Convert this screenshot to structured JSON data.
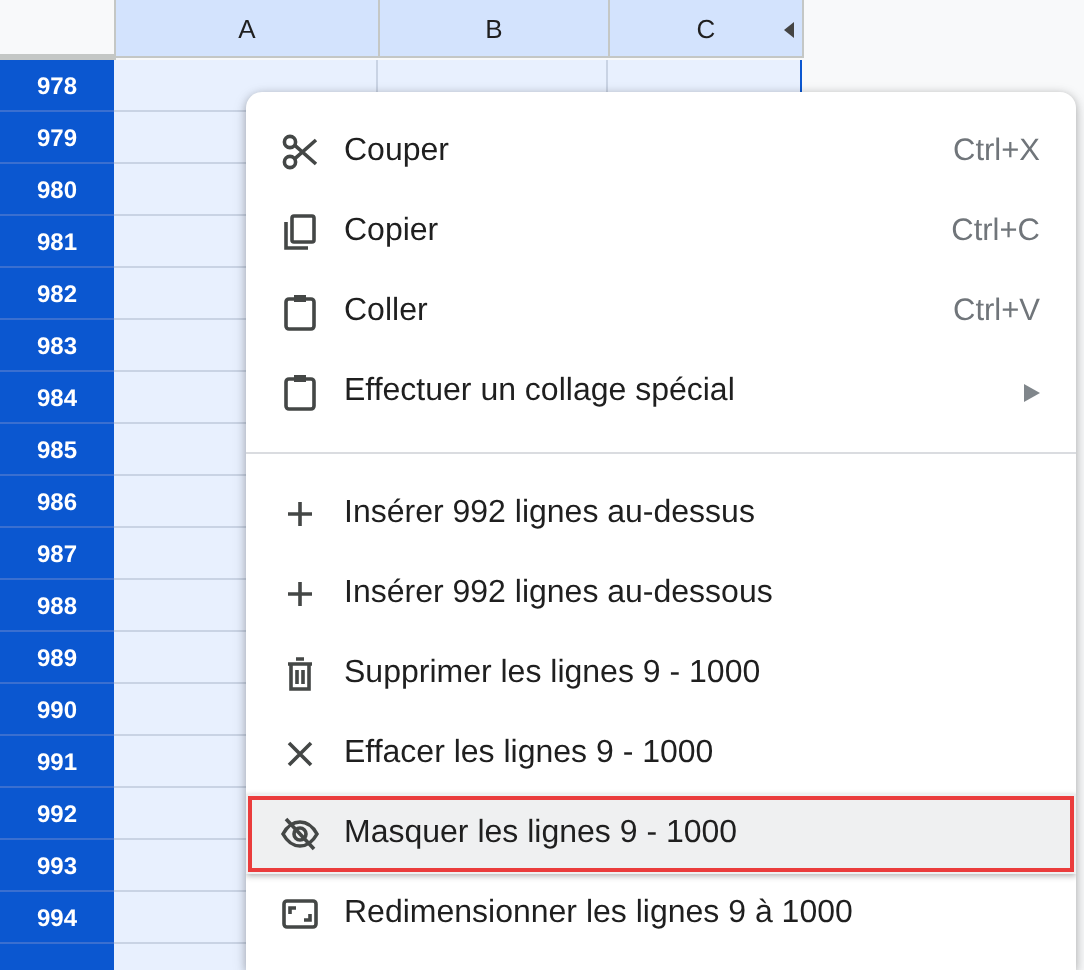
{
  "columns": [
    {
      "label": "A",
      "selected": true
    },
    {
      "label": "B",
      "selected": true
    },
    {
      "label": "C",
      "selected": true
    }
  ],
  "rows": [
    {
      "label": "978",
      "selected": true
    },
    {
      "label": "979",
      "selected": true
    },
    {
      "label": "980",
      "selected": true
    },
    {
      "label": "981",
      "selected": true
    },
    {
      "label": "982",
      "selected": true
    },
    {
      "label": "983",
      "selected": true
    },
    {
      "label": "984",
      "selected": true
    },
    {
      "label": "985",
      "selected": true
    },
    {
      "label": "986",
      "selected": true
    },
    {
      "label": "987",
      "selected": true
    },
    {
      "label": "988",
      "selected": true
    },
    {
      "label": "989",
      "selected": true
    },
    {
      "label": "990",
      "selected": true
    },
    {
      "label": "991",
      "selected": true
    },
    {
      "label": "992",
      "selected": true
    },
    {
      "label": "993",
      "selected": true
    },
    {
      "label": "994",
      "selected": true
    },
    {
      "selected": true
    }
  ],
  "context_menu": {
    "items": [
      {
        "kind": "item",
        "label": "Couper",
        "shortcut": "Ctrl+X",
        "submenu": false,
        "highlighted": false
      },
      {
        "kind": "item",
        "label": "Copier",
        "shortcut": "Ctrl+C",
        "submenu": false,
        "highlighted": false
      },
      {
        "kind": "item",
        "label": "Coller",
        "shortcut": "Ctrl+V",
        "submenu": false,
        "highlighted": false
      },
      {
        "kind": "item",
        "label": "Effectuer un collage spécial",
        "submenu": true,
        "highlighted": false
      },
      {
        "kind": "divider"
      },
      {
        "kind": "item",
        "label": "Insérer 992 lignes au-dessus",
        "submenu": false,
        "highlighted": false
      },
      {
        "kind": "item",
        "label": "Insérer 992 lignes au-dessous",
        "submenu": false,
        "highlighted": false
      },
      {
        "kind": "item",
        "label": "Supprimer les lignes 9 - 1000",
        "submenu": false,
        "highlighted": false
      },
      {
        "kind": "item",
        "label": "Effacer les lignes 9 - 1000",
        "submenu": false,
        "highlighted": false
      },
      {
        "kind": "item",
        "label": "Masquer les lignes 9 - 1000",
        "submenu": false,
        "highlighted": true
      },
      {
        "kind": "item",
        "label": "Redimensionner les lignes 9 à 1000",
        "submenu": false,
        "highlighted": false
      }
    ]
  }
}
